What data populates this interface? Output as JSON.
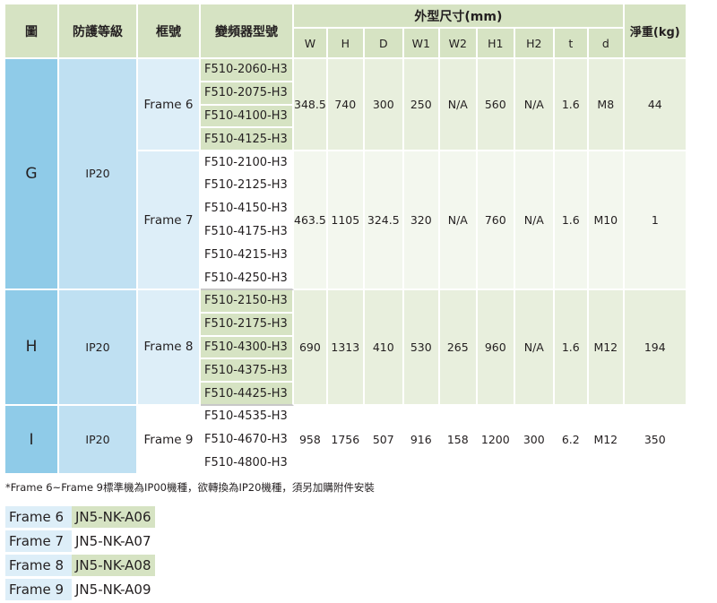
{
  "header": {
    "group": "圖",
    "protection": "防護等級",
    "frame": "框號",
    "model": "變頻器型號",
    "dimensions": "外型尺寸(mm)",
    "weight": "淨重(kg)",
    "dim_cols": [
      "W",
      "H",
      "D",
      "W1",
      "W2",
      "H1",
      "H2",
      "t",
      "d"
    ]
  },
  "groups": [
    {
      "label": "G",
      "protection": "IP20",
      "frames": [
        {
          "name": "Frame 6",
          "models": [
            "F510-2060-H3",
            "F510-2075-H3",
            "F510-4100-H3",
            "F510-4125-H3"
          ],
          "dims": [
            "348.5",
            "740",
            "300",
            "250",
            "N/A",
            "560",
            "N/A",
            "1.6",
            "M8"
          ],
          "weight": "44"
        },
        {
          "name": "Frame 7",
          "models": [
            "F510-2100-H3",
            "F510-2125-H3",
            "F510-4150-H3",
            "F510-4175-H3",
            "F510-4215-H3",
            "F510-4250-H3"
          ],
          "dims": [
            "463.5",
            "1105",
            "324.5",
            "320",
            "N/A",
            "760",
            "N/A",
            "1.6",
            "M10"
          ],
          "weight": "1"
        }
      ]
    },
    {
      "label": "H",
      "protection": "IP20",
      "frames": [
        {
          "name": "Frame 8",
          "models": [
            "F510-2150-H3",
            "F510-2175-H3",
            "F510-4300-H3",
            "F510-4375-H3",
            "F510-4425-H3"
          ],
          "dims": [
            "690",
            "1313",
            "410",
            "530",
            "265",
            "960",
            "N/A",
            "1.6",
            "M12"
          ],
          "weight": "194"
        }
      ]
    },
    {
      "label": "I",
      "protection": "IP20",
      "frames": [
        {
          "name": "Frame 9",
          "models": [
            "F510-4535-H3",
            "F510-4670-H3",
            "F510-4800-H3"
          ],
          "dims": [
            "958",
            "1756",
            "507",
            "916",
            "158",
            "1200",
            "300",
            "6.2",
            "M12"
          ],
          "weight": "350"
        }
      ]
    }
  ],
  "note": "*Frame 6~Frame 9標準機為IP00機種，欲轉換為IP20機種，須另加購附件安裝",
  "accessories": [
    {
      "frame": "Frame 6",
      "kit": "JN5-NK-A06"
    },
    {
      "frame": "Frame 7",
      "kit": "JN5-NK-A07"
    },
    {
      "frame": "Frame 8",
      "kit": "JN5-NK-A08"
    },
    {
      "frame": "Frame 9",
      "kit": "JN5-NK-A09"
    }
  ]
}
